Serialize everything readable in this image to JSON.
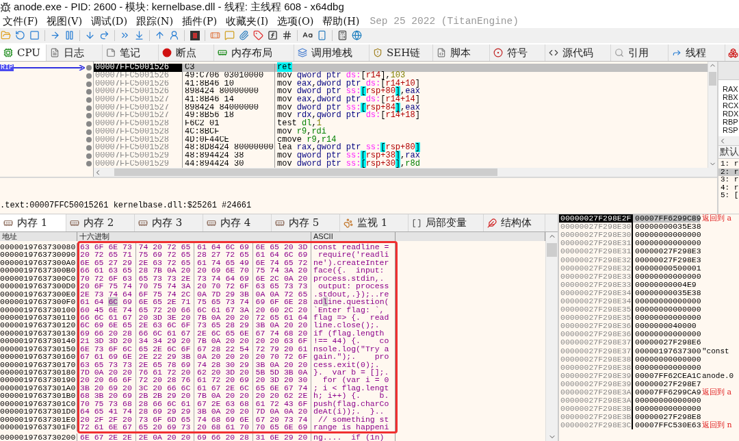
{
  "window": {
    "title": "anode.exe - PID: 2600 - 模块: kernelbase.dll - 线程: 主线程 608 - x64dbg"
  },
  "menu": [
    "文件(F)",
    "视图(V)",
    "调试(D)",
    "跟踪(N)",
    "插件(P)",
    "收藏夹(I)",
    "选项(O)",
    "帮助(H)"
  ],
  "build_info": "Sep 25 2022 (TitanEngine)",
  "tabs": [
    {
      "label": "CPU",
      "selected": true
    },
    {
      "label": "日志",
      "selected": false
    },
    {
      "label": "笔记",
      "selected": false
    },
    {
      "label": "断点",
      "selected": false
    },
    {
      "label": "内存布局",
      "selected": false
    },
    {
      "label": "调用堆栈",
      "selected": false
    },
    {
      "label": "SEH链",
      "selected": false
    },
    {
      "label": "脚本",
      "selected": false
    },
    {
      "label": "符号",
      "selected": false
    },
    {
      "label": "源代码",
      "selected": false
    },
    {
      "label": "引用",
      "selected": false
    },
    {
      "label": "线程",
      "selected": false
    }
  ],
  "disassembly": {
    "rip_label": "RIP",
    "rows": [
      {
        "address": "00007FFC5001526",
        "bytes": "C3",
        "selected": true,
        "tokens": [
          {
            "kind": "hl",
            "text": "ret"
          }
        ]
      },
      {
        "address": "00007FFC5001526",
        "bytes": "49:C706 03010000",
        "selected": false,
        "tokens": [
          {
            "kind": "mn",
            "text": "mov "
          },
          {
            "kind": "sz",
            "text": "qword ptr "
          },
          {
            "kind": "seg",
            "text": "ds:"
          },
          {
            "kind": "p",
            "text": "["
          },
          {
            "kind": "mem",
            "text": "r14"
          },
          {
            "kind": "p",
            "text": "],"
          },
          {
            "kind": "num",
            "text": "103"
          }
        ]
      },
      {
        "address": "00007FFC5001526",
        "bytes": "41:8B46 10",
        "selected": false,
        "tokens": [
          {
            "kind": "mn",
            "text": "mov "
          },
          {
            "kind": "gpr",
            "text": "eax"
          },
          {
            "kind": "p",
            "text": ","
          },
          {
            "kind": "sz",
            "text": "dword ptr "
          },
          {
            "kind": "seg",
            "text": "ds:"
          },
          {
            "kind": "p",
            "text": "["
          },
          {
            "kind": "mem",
            "text": "r14+10"
          },
          {
            "kind": "p",
            "text": "]"
          }
        ]
      },
      {
        "address": "00007FFC5001526",
        "bytes": "898424 80000000",
        "selected": false,
        "tokens": [
          {
            "kind": "mn",
            "text": "mov "
          },
          {
            "kind": "sz",
            "text": "dword ptr "
          },
          {
            "kind": "seg",
            "text": "ss:"
          },
          {
            "kind": "br",
            "text": "["
          },
          {
            "kind": "mem",
            "text": "rsp+80"
          },
          {
            "kind": "br",
            "text": "]"
          },
          {
            "kind": "p",
            "text": ","
          },
          {
            "kind": "gpr",
            "text": "eax"
          }
        ]
      },
      {
        "address": "00007FFC5001527",
        "bytes": "41:8B46 14",
        "selected": false,
        "tokens": [
          {
            "kind": "mn",
            "text": "mov "
          },
          {
            "kind": "gpr",
            "text": "eax"
          },
          {
            "kind": "p",
            "text": ","
          },
          {
            "kind": "sz",
            "text": "dword ptr "
          },
          {
            "kind": "seg",
            "text": "ds:"
          },
          {
            "kind": "p",
            "text": "["
          },
          {
            "kind": "mem",
            "text": "r14+14"
          },
          {
            "kind": "p",
            "text": "]"
          }
        ]
      },
      {
        "address": "00007FFC5001527",
        "bytes": "898424 84000000",
        "selected": false,
        "tokens": [
          {
            "kind": "mn",
            "text": "mov "
          },
          {
            "kind": "sz",
            "text": "dword ptr "
          },
          {
            "kind": "seg",
            "text": "ss:"
          },
          {
            "kind": "br",
            "text": "["
          },
          {
            "kind": "mem",
            "text": "rsp+84"
          },
          {
            "kind": "br",
            "text": "]"
          },
          {
            "kind": "p",
            "text": ","
          },
          {
            "kind": "gpr",
            "text": "eax"
          }
        ]
      },
      {
        "address": "00007FFC5001527",
        "bytes": "49:8B56 18",
        "selected": false,
        "tokens": [
          {
            "kind": "mn",
            "text": "mov "
          },
          {
            "kind": "gpr",
            "text": "rdx"
          },
          {
            "kind": "p",
            "text": ","
          },
          {
            "kind": "sz",
            "text": "qword ptr "
          },
          {
            "kind": "seg",
            "text": "ds:"
          },
          {
            "kind": "p",
            "text": "["
          },
          {
            "kind": "mem",
            "text": "r14+18"
          },
          {
            "kind": "p",
            "text": "]"
          }
        ]
      },
      {
        "address": "00007FFC5001528",
        "bytes": "F6C2 01",
        "selected": false,
        "tokens": [
          {
            "kind": "mn",
            "text": "test "
          },
          {
            "kind": "reg",
            "text": "dl"
          },
          {
            "kind": "p",
            "text": ","
          },
          {
            "kind": "num",
            "text": "1"
          }
        ]
      },
      {
        "address": "00007FFC5001528",
        "bytes": "4C:8BCF",
        "selected": false,
        "tokens": [
          {
            "kind": "mn",
            "text": "mov "
          },
          {
            "kind": "reg",
            "text": "r9"
          },
          {
            "kind": "p",
            "text": ","
          },
          {
            "kind": "reg",
            "text": "rdi"
          }
        ]
      },
      {
        "address": "00007FFC5001528",
        "bytes": "4D:0F44CE",
        "selected": false,
        "tokens": [
          {
            "kind": "mn",
            "text": "cmove "
          },
          {
            "kind": "reg",
            "text": "r9"
          },
          {
            "kind": "p",
            "text": ","
          },
          {
            "kind": "reg",
            "text": "r14"
          }
        ]
      },
      {
        "address": "00007FFC5001528",
        "bytes": "48:8D8424 80000000",
        "selected": false,
        "tokens": [
          {
            "kind": "mn",
            "text": "lea "
          },
          {
            "kind": "gpr",
            "text": "rax"
          },
          {
            "kind": "p",
            "text": ","
          },
          {
            "kind": "sz",
            "text": "qword ptr "
          },
          {
            "kind": "seg",
            "text": "ss:"
          },
          {
            "kind": "br",
            "text": "["
          },
          {
            "kind": "mem",
            "text": "rsp+80"
          },
          {
            "kind": "br",
            "text": "]"
          }
        ]
      },
      {
        "address": "00007FFC5001529",
        "bytes": "48:894424 38",
        "selected": false,
        "tokens": [
          {
            "kind": "mn",
            "text": "mov "
          },
          {
            "kind": "sz",
            "text": "qword ptr "
          },
          {
            "kind": "seg",
            "text": "ss:"
          },
          {
            "kind": "br",
            "text": "["
          },
          {
            "kind": "mem",
            "text": "rsp+38"
          },
          {
            "kind": "br",
            "text": "]"
          },
          {
            "kind": "p",
            "text": ","
          },
          {
            "kind": "gpr",
            "text": "rax"
          }
        ]
      },
      {
        "address": "00007FFC5001529",
        "bytes": "44:894424 30",
        "selected": false,
        "tokens": [
          {
            "kind": "mn",
            "text": "mov "
          },
          {
            "kind": "sz",
            "text": "dword ptr "
          },
          {
            "kind": "seg",
            "text": "ss:"
          },
          {
            "kind": "br",
            "text": "["
          },
          {
            "kind": "mem",
            "text": "rsp+30"
          },
          {
            "kind": "br",
            "text": "]"
          },
          {
            "kind": "p",
            "text": ","
          },
          {
            "kind": "reg",
            "text": "r8d"
          }
        ]
      }
    ]
  },
  "info_line": ".text:00007FFC50015261 kernelbase.dll:$25261 #24661",
  "registers": {
    "names": [
      "RAX",
      "RBX",
      "RCX",
      "RDX",
      "RBP",
      "RSP"
    ],
    "tab": "默认",
    "args": [
      {
        "label": "1: r",
        "selected": false
      },
      {
        "label": "2: r",
        "selected": true
      },
      {
        "label": "3: r",
        "selected": false
      },
      {
        "label": "4: r",
        "selected": false
      },
      {
        "label": "5: [",
        "selected": false
      }
    ]
  },
  "memory_tabs": [
    {
      "label": "内存 1",
      "selected": true
    },
    {
      "label": "内存 2",
      "selected": false
    },
    {
      "label": "内存 3",
      "selected": false
    },
    {
      "label": "内存 4",
      "selected": false
    },
    {
      "label": "内存 5",
      "selected": false
    },
    {
      "label": "监视 1",
      "selected": false
    },
    {
      "label": "局部变量",
      "selected": false
    },
    {
      "label": "结构体",
      "selected": false
    }
  ],
  "hex_view": {
    "highlight": true,
    "columns": [
      "地址",
      "十六进制",
      "ASCII"
    ],
    "rows": [
      {
        "address": "0000019763730080",
        "hex": [
          "63 6F 6E 73",
          "74 20 72 65",
          "61 64 6C 69",
          "6E 65 20 3D"
        ],
        "ascii": "const readline ="
      },
      {
        "address": "0000019763730090",
        "hex": [
          "20 72 65 71",
          "75 69 72 65",
          "28 27 72 65",
          "61 64 6C 69"
        ],
        "ascii": " require('readli"
      },
      {
        "address": "00000197637300A0",
        "hex": [
          "6E 65 27 29",
          "2E 63 72 65",
          "61 74 65 49",
          "6E 74 65 72"
        ],
        "ascii": "ne').createInter"
      },
      {
        "address": "00000197637300B0",
        "hex": [
          "66 61 63 65",
          "28 7B 0A 20",
          "20 69 6E 70",
          "75 74 3A 20"
        ],
        "ascii": "face({.  input: "
      },
      {
        "address": "00000197637300C0",
        "hex": [
          "70 72 6F 63",
          "65 73 73 2E",
          "73 74 64 69",
          "6E 2C 0A 20"
        ],
        "ascii": "process.stdin,. "
      },
      {
        "address": "00000197637300D0",
        "hex": [
          "20 6F 75 74",
          "70 75 74 3A",
          "20 70 72 6F",
          "63 65 73 73"
        ],
        "ascii": " output: process"
      },
      {
        "address": "00000197637300E0",
        "hex": [
          "2E 73 74 64",
          "6F 75 74 2C",
          "0A 7D 29 3B",
          "0A 0A 72 65"
        ],
        "ascii": ".stdout,.});..re"
      },
      {
        "address": "00000197637300F0",
        "hex": [
          [
            "61 64 ",
            "6C",
            " 69"
          ],
          "6E 65 2E 71",
          "75 65 73 74",
          "69 6F 6E 28"
        ],
        "ascii": [
          "ad",
          "l",
          "ine.question("
        ]
      },
      {
        "address": "0000019763730100",
        "hex": [
          "60 45 6E 74",
          "65 72 20 66",
          "6C 61 67 3A",
          "20 60 2C 20"
        ],
        "ascii": "`Enter flag: `, "
      },
      {
        "address": "0000019763730110",
        "hex": [
          "66 6C 61 67",
          "20 3D 3E 20",
          "7B 0A 20 20",
          "72 65 61 64"
        ],
        "ascii": "flag => {.  read"
      },
      {
        "address": "0000019763730120",
        "hex": [
          "6C 69 6E 65",
          "2E 63 6C 6F",
          "73 65 28 29",
          "3B 0A 20 20"
        ],
        "ascii": "line.close();.  "
      },
      {
        "address": "0000019763730130",
        "hex": [
          "69 66 20 28",
          "66 6C 61 67",
          "2E 6C 65 6E",
          "67 74 68 20"
        ],
        "ascii": "if (flag.length "
      },
      {
        "address": "0000019763730140",
        "hex": [
          "21 3D 3D 20",
          "34 34 29 20",
          "7B 0A 20 20",
          "20 20 63 6F"
        ],
        "ascii": "!== 44) {.    co"
      },
      {
        "address": "0000019763730150",
        "hex": [
          "6E 73 6F 6C",
          "65 2E 6C 6F",
          "67 28 22 54",
          "72 79 20 61"
        ],
        "ascii": "nsole.log(\"Try a"
      },
      {
        "address": "0000019763730160",
        "hex": [
          "67 61 69 6E",
          "2E 22 29 3B",
          "0A 20 20 20",
          "20 70 72 6F"
        ],
        "ascii": "gain.\");.    pro"
      },
      {
        "address": "0000019763730170",
        "hex": [
          "63 65 73 73",
          "2E 65 78 69",
          "74 28 30 29",
          "3B 0A 20 20"
        ],
        "ascii": "cess.exit(0);.  "
      },
      {
        "address": "0000019763730180",
        "hex": [
          "7D 0A 20 20",
          "76 61 72 20",
          "62 20 3D 20",
          "5B 5D 3B 0A"
        ],
        "ascii": "}.  var b = [];."
      },
      {
        "address": "0000019763730190",
        "hex": [
          "20 20 66 6F",
          "72 20 28 76",
          "61 72 20 69",
          "20 3D 20 30"
        ],
        "ascii": "  for (var i = 0"
      },
      {
        "address": "00000197637301A0",
        "hex": [
          "3B 20 69 20",
          "3C 20 66 6C",
          "61 67 2E 6C",
          "65 6E 67 74"
        ],
        "ascii": "; i < flag.lengt"
      },
      {
        "address": "00000197637301B0",
        "hex": [
          "68 3B 20 69",
          "2B 2B 29 20",
          "7B 0A 20 20",
          "20 20 62 2E"
        ],
        "ascii": "h; i++) {.    b."
      },
      {
        "address": "00000197637301C0",
        "hex": [
          "70 75 73 68",
          "28 66 6C 61",
          "67 2E 63 68",
          "61 72 43 6F"
        ],
        "ascii": "push(flag.charCo"
      },
      {
        "address": "00000197637301D0",
        "hex": [
          "64 65 41 74",
          "28 69 29 29",
          "3B 0A 20 20",
          "7D 0A 0A 20"
        ],
        "ascii": "deAt(i));.  }.. "
      },
      {
        "address": "00000197637301E0",
        "hex": [
          "20 2F 2F 20",
          "73 6F 6D 65",
          "74 68 69 6E",
          "67 20 73 74"
        ],
        "ascii": " // something st"
      },
      {
        "address": "00000197637301F0",
        "hex": [
          "72 61 6E 67",
          "65 20 69 73",
          "20 68 61 70",
          "70 65 6E 69"
        ],
        "ascii": "range is happeni"
      },
      {
        "address": "0000019763730200",
        "hex": [
          "6E 67 2E 2E",
          "2E 0A 20 20",
          "69 66 20 28",
          "31 6E 29 20"
        ],
        "ascii": "ng....  if (1n) "
      }
    ]
  },
  "stack": [
    {
      "address": "00000027F298E2F",
      "value": "00007FF6299C89",
      "comment": "返回到 a",
      "kind": "return",
      "selected": true
    },
    {
      "address": "00000027F298E30",
      "value": "00000000035E38",
      "selected": false
    },
    {
      "address": "00000027F298E30",
      "value": "00000000000000",
      "selected": false
    },
    {
      "address": "00000027F298E31",
      "value": "00000000000000",
      "selected": false
    },
    {
      "address": "00000027F298E31",
      "value": "00000027F298E3",
      "selected": false
    },
    {
      "address": "00000027F298E32",
      "value": "00000027F298E3",
      "selected": false
    },
    {
      "address": "00000027F298E32",
      "value": "00000000500001",
      "selected": false
    },
    {
      "address": "00000027F298E33",
      "value": "00000000000000",
      "selected": false
    },
    {
      "address": "00000027F298E33",
      "value": "00000000004E9",
      "selected": false
    },
    {
      "address": "00000027F298E34",
      "value": "00000000035E38",
      "selected": false
    },
    {
      "address": "00000027F298E34",
      "value": "00000000000000",
      "selected": false
    },
    {
      "address": "00000027F298E35",
      "value": "00000000000000",
      "selected": false
    },
    {
      "address": "00000027F298E35",
      "value": "00000000000000",
      "selected": false
    },
    {
      "address": "00000027F298E36",
      "value": "0000000040000",
      "selected": false
    },
    {
      "address": "00000027F298E36",
      "value": "00000000000000",
      "selected": false
    },
    {
      "address": "00000027F298E37",
      "value": "00000027F298E6",
      "selected": false
    },
    {
      "address": "00000027F298E37",
      "value": "00000197637300",
      "comment": "\"const",
      "kind": "plain",
      "selected": false
    },
    {
      "address": "00000027F298E38",
      "value": "00000000000000",
      "selected": false
    },
    {
      "address": "00000027F298E38",
      "value": "00000000000000",
      "selected": false
    },
    {
      "address": "00000027F298E39",
      "value": "00007FF62CEA1C",
      "comment": "anode.0",
      "kind": "plain",
      "selected": false
    },
    {
      "address": "00000027F298E39",
      "value": "00000027F298E7",
      "selected": false
    },
    {
      "address": "00000027F298E3A",
      "value": "00007FF6299CA9",
      "comment": "返回到 a",
      "kind": "return",
      "selected": false
    },
    {
      "address": "00000027F298E3A",
      "value": "00000000000000",
      "selected": false
    },
    {
      "address": "00000027F298E3B",
      "value": "00000000000000",
      "selected": false
    },
    {
      "address": "00000027F298E3B",
      "value": "00000027F298E8",
      "selected": false
    },
    {
      "address": "00000027F298E3C",
      "value": "00007FFC530E63",
      "comment": "返回到 n",
      "kind": "return",
      "selected": false
    }
  ]
}
